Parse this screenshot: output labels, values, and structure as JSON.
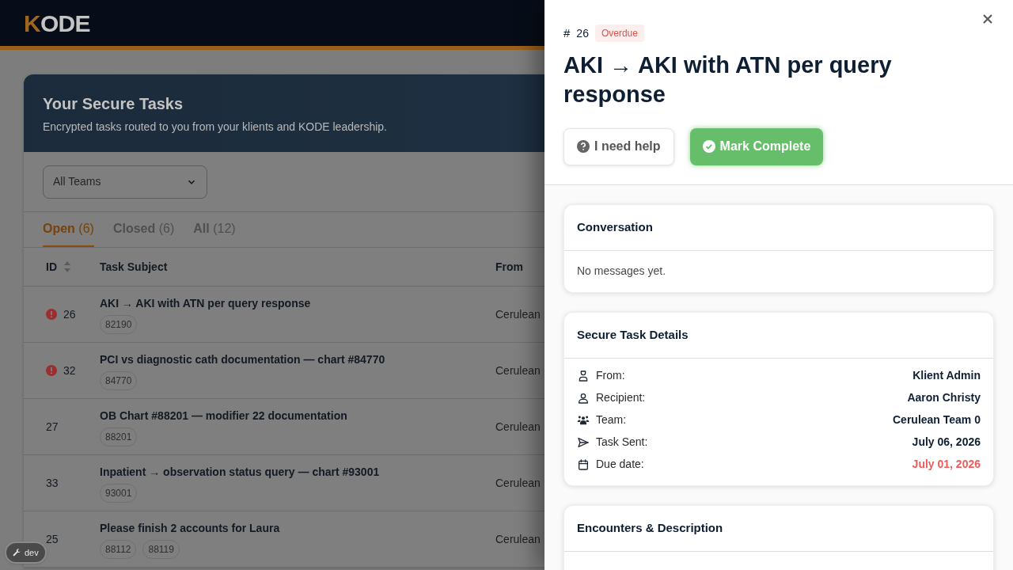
{
  "header": {
    "logo_accent": "K",
    "logo_rest": "ODE"
  },
  "tasks_panel": {
    "title": "Your Secure Tasks",
    "subtitle": "Encrypted tasks routed to you from your klients and KODE leadership.",
    "team_filter": {
      "value": "All Teams"
    },
    "tabs": [
      {
        "label": "Open",
        "count": "(6)",
        "selected": true
      },
      {
        "label": "Closed",
        "count": "(6)",
        "selected": false
      },
      {
        "label": "All",
        "count": "(12)",
        "selected": false
      }
    ],
    "columns": [
      "ID",
      "Task Subject",
      "From"
    ],
    "rows": [
      {
        "id": "26",
        "overdue": true,
        "subject": "AKI → AKI with ATN per query response",
        "chips": [
          "82190"
        ],
        "from": "Cerulean"
      },
      {
        "id": "32",
        "overdue": true,
        "subject": "PCI vs diagnostic cath documentation — chart #84770",
        "chips": [
          "84770"
        ],
        "from": "Cerulean"
      },
      {
        "id": "27",
        "overdue": false,
        "subject": "OB Chart #88201 — modifier 22 documentation",
        "chips": [
          "88201"
        ],
        "from": "Cerulean"
      },
      {
        "id": "33",
        "overdue": false,
        "subject": "Inpatient → observation status query — chart #93001",
        "chips": [
          "93001"
        ],
        "from": "Cerulean"
      },
      {
        "id": "25",
        "overdue": false,
        "subject": "Please finish 2 accounts for Laura",
        "chips": [
          "88112",
          "88119"
        ],
        "from": "Cerulean"
      }
    ]
  },
  "dev_badge": {
    "label": "dev"
  },
  "drawer": {
    "hash": "#",
    "id": "26",
    "status": "Overdue",
    "title": "AKI → AKI with ATN per query response",
    "buttons": [
      {
        "kind": "help",
        "label": "I need help"
      },
      {
        "kind": "complete",
        "label": "Mark Complete"
      }
    ],
    "conversation": {
      "title": "Conversation",
      "empty_text": "No messages yet."
    },
    "details": {
      "title": "Secure Task Details",
      "rows": [
        {
          "kind": "from",
          "label": "From:",
          "value": "Klient Admin",
          "overdue": false
        },
        {
          "kind": "recipient",
          "label": "Recipient:",
          "value": "Aaron Christy",
          "overdue": false
        },
        {
          "kind": "team",
          "label": "Team:",
          "value": "Cerulean Team 0",
          "overdue": false
        },
        {
          "kind": "sent",
          "label": "Task Sent:",
          "value": "July 06, 2026",
          "overdue": false
        },
        {
          "kind": "due",
          "label": "Due date:",
          "value": "July 01, 2026",
          "overdue": true
        }
      ]
    },
    "encounters": {
      "title": "Encounters & Description"
    }
  }
}
